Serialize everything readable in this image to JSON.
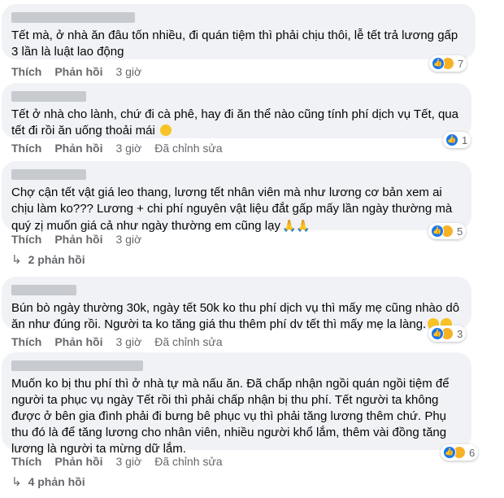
{
  "comments": [
    {
      "text": "Tết mà, ở nhà ăn đâu tốn nhiều, đi quán tiệm thì phải chịu thôi, lễ tết trả lương gấp 3 lần là luật lao động",
      "reaction_count": "7",
      "like_label": "Thích",
      "reply_label": "Phản hồi",
      "time": "3 giờ"
    },
    {
      "text": "Tết ở nhà cho lành, chứ đi cà phê, hay đi ăn thể nào cũng tính phí dịch vụ Tết, qua tết đi rồi ăn uống thoải mái",
      "reaction_count": "1",
      "like_label": "Thích",
      "reply_label": "Phản hồi",
      "time": "3 giờ",
      "edited": "Đã chỉnh sửa"
    },
    {
      "text": "Chợ cận tết vật giá leo thang, lương tết nhân viên mà như lương cơ bản xem ai chịu làm ko??? Lương + chi phí nguyên vật liệu đắt gấp mấy lần ngày thường mà quý zị muốn giá cả như ngày thường em cũng lạy",
      "reaction_count": "5",
      "like_label": "Thích",
      "reply_label": "Phản hồi",
      "time": "3 giờ",
      "replies": "2 phản hồi"
    },
    {
      "text": "Bún bò ngày thường 30k, ngày tết 50k ko thu phí dịch vụ thì mấy mẹ cũng nhào dô ăn như đúng rồi. Người ta ko tăng giá thu thêm phí dv tết thì mấy mẹ la làng.",
      "reaction_count": "3",
      "like_label": "Thích",
      "reply_label": "Phản hồi",
      "time": "3 giờ",
      "edited": "Đã chỉnh sửa"
    },
    {
      "text": "Muốn ko bị thu phí thì ở nhà tự mà nấu ăn. Đã chấp nhận ngồi quán ngồi tiệm để người ta phục vụ ngày Tết rồi thì phải chấp nhận bị thu phí. Tết người ta không được ở bên gia đình phải đi bưng bê phục vụ thì phải tăng lương thêm chứ. Phụ thu đó là để tăng lương cho nhân viên, nhiều người khổ lắm, thêm vài đồng tăng lương là người ta mừng dữ lắm.",
      "reaction_count": "6",
      "like_label": "Thích",
      "reply_label": "Phản hồi",
      "time": "3 giờ",
      "edited": "Đã chỉnh sửa",
      "replies": "4 phản hồi"
    }
  ],
  "icons": {
    "like": "like-reaction-icon",
    "haha": "haha-reaction-icon",
    "wow": "wow-reaction-icon",
    "reply_arrow": "reply-arrow-icon"
  },
  "colors": {
    "bubble": "#f0f2f5",
    "secondary_text": "#65676b",
    "like_blue": "#1877f2",
    "emoji_yellow": "#f7b125"
  }
}
